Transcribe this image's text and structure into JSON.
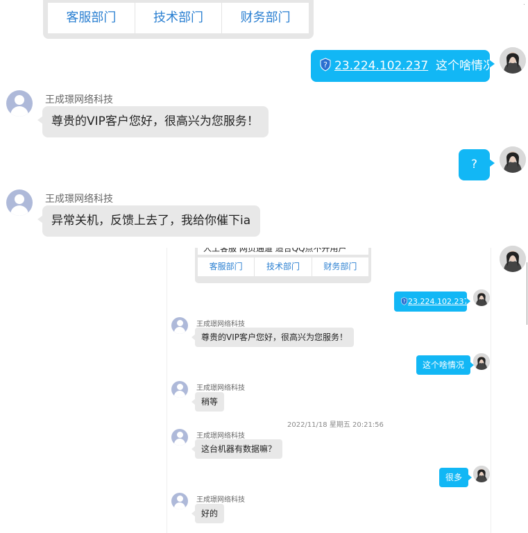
{
  "top_card": {
    "departments": [
      "客服部门",
      "技术部门",
      "财务部门"
    ]
  },
  "messages": [
    {
      "id": "m1",
      "dir": "out",
      "ip": "23.224.102.237",
      "text": "这个啥情况"
    },
    {
      "id": "m2",
      "dir": "in",
      "sender": "王成璟网络科技",
      "text": "尊贵的VIP客户您好，很高兴为您服务！"
    },
    {
      "id": "m3",
      "dir": "out",
      "text": "?"
    },
    {
      "id": "m4",
      "dir": "in",
      "sender": "王成璟网络科技",
      "text": "异常关机，反馈上去了，我给你催下ia"
    }
  ],
  "embedded": {
    "card_top_text": "人工客服 网页通道 适合QQ点不开用户",
    "departments": [
      "客服部门",
      "技术部门",
      "财务部门"
    ],
    "ip": "23.224.102.237",
    "sender": "王成璟网络科技",
    "greeting": "尊贵的VIP客户您好，很高兴为您服务！",
    "user_msg_1": "这个啥情况",
    "reply_wait": "稍等",
    "timestamp": "2022/11/18 星期五 20:21:56",
    "question": "这台机器有数据嘛？",
    "user_msg_2": "很多",
    "reply_ok": "好的"
  },
  "colors": {
    "outgoing": "#12b7f5",
    "incoming": "#e8e8e8",
    "link": "#2a7fd1"
  },
  "icons": {
    "verify": "shield-question-icon"
  }
}
